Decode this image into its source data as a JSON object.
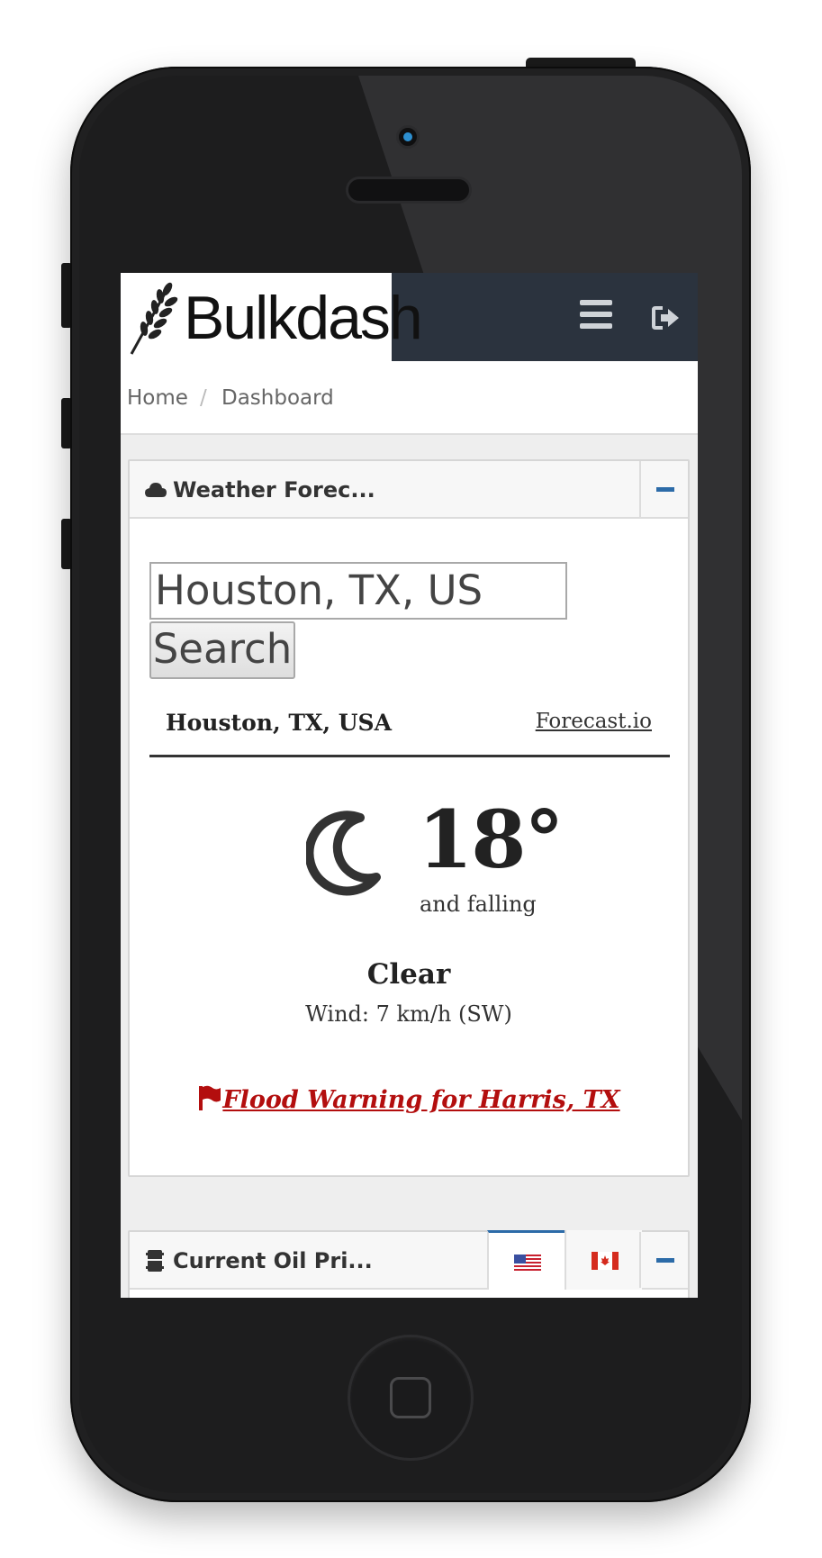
{
  "brand": {
    "name": "Bulkdash",
    "logo_icon": "wheat-icon"
  },
  "navbar": {
    "menu_icon": "hamburger-icon",
    "logout_icon": "sign-out-icon",
    "background": "#2b333e"
  },
  "breadcrumb": {
    "home": "Home",
    "separator": "/",
    "current": "Dashboard"
  },
  "weather_widget": {
    "title": "Weather Forec...",
    "title_icon": "cloud-icon",
    "collapse_icon": "minus-icon",
    "input_value": "Houston, TX, US",
    "search_label": "Search",
    "location": "Houston, TX, USA",
    "source_link": "Forecast.io",
    "condition_icon": "moon-icon",
    "temperature": "18°",
    "trend": "and falling",
    "summary": "Clear",
    "wind": "Wind: 7 km/h (SW)",
    "alert": "Flood Warning for Harris, TX",
    "alert_icon": "flag-icon",
    "alert_color": "#b30e0e"
  },
  "oil_widget": {
    "title": "Current Oil Pri...",
    "title_icon": "barrel-icon",
    "tabs": [
      {
        "icon": "us-flag-icon",
        "active": true
      },
      {
        "icon": "canada-flag-icon",
        "active": false
      }
    ],
    "collapse_icon": "minus-icon"
  },
  "colors": {
    "accent": "#2c6ba8",
    "page_background": "#eeeeee"
  }
}
